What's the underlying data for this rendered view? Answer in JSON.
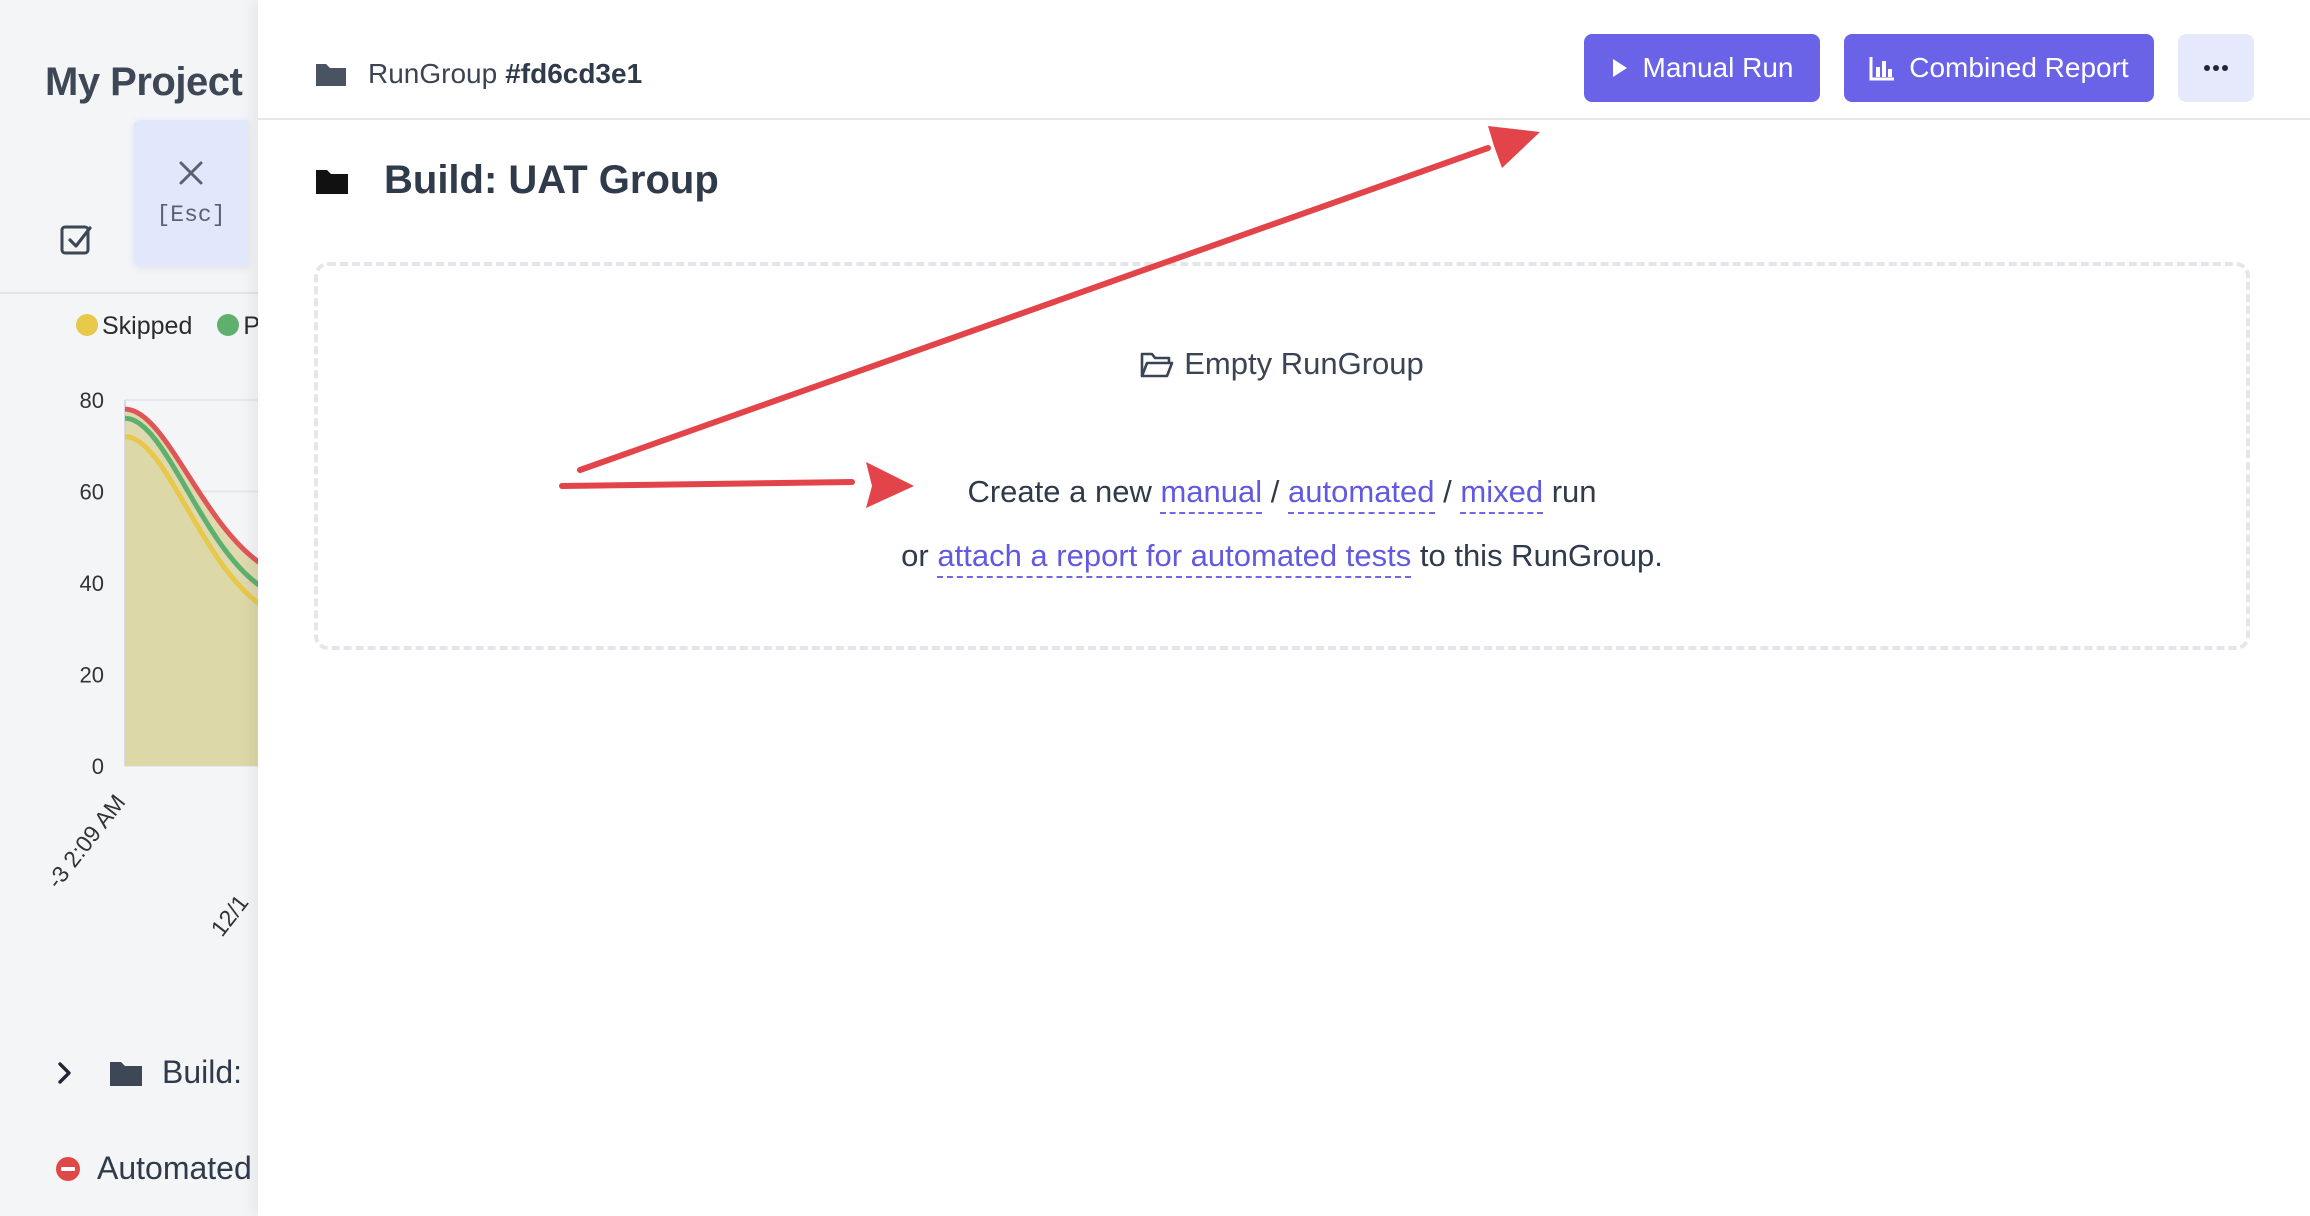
{
  "sidebar": {
    "project_title": "My Project",
    "legend": {
      "skipped": "Skipped",
      "second": "P"
    },
    "tree_item": "Build:",
    "run_item": "Automated"
  },
  "close_button": {
    "label": "[Esc]"
  },
  "header": {
    "breadcrumb_label": "RunGroup",
    "breadcrumb_id": "#fd6cd3e1",
    "manual_run": "Manual Run",
    "combined_report": "Combined Report"
  },
  "page": {
    "title": "Build: UAT Group"
  },
  "empty_state": {
    "title": "Empty RunGroup",
    "create_prefix": "Create a new",
    "link_manual": "manual",
    "link_automated": "automated",
    "link_mixed": "mixed",
    "sep": "/",
    "run_suffix": "run",
    "or_prefix": "or",
    "link_attach": "attach a report for automated tests",
    "attach_suffix": "to this RunGroup."
  },
  "chart_data": {
    "type": "area",
    "y_ticks": [
      "80",
      "60",
      "40",
      "20",
      "0"
    ],
    "ylim": [
      0,
      80
    ],
    "x_labels": [
      "-3 2:09 AM",
      "12/1"
    ],
    "series": [
      {
        "name": "Skipped",
        "color": "#e8c84a",
        "values": [
          72,
          38
        ]
      },
      {
        "color": "#5fb06f",
        "values": [
          76,
          42
        ]
      },
      {
        "color": "#e05555",
        "values": [
          78,
          47
        ]
      }
    ]
  },
  "colors": {
    "accent": "#6a63e8",
    "arrow": "#e3444a"
  }
}
